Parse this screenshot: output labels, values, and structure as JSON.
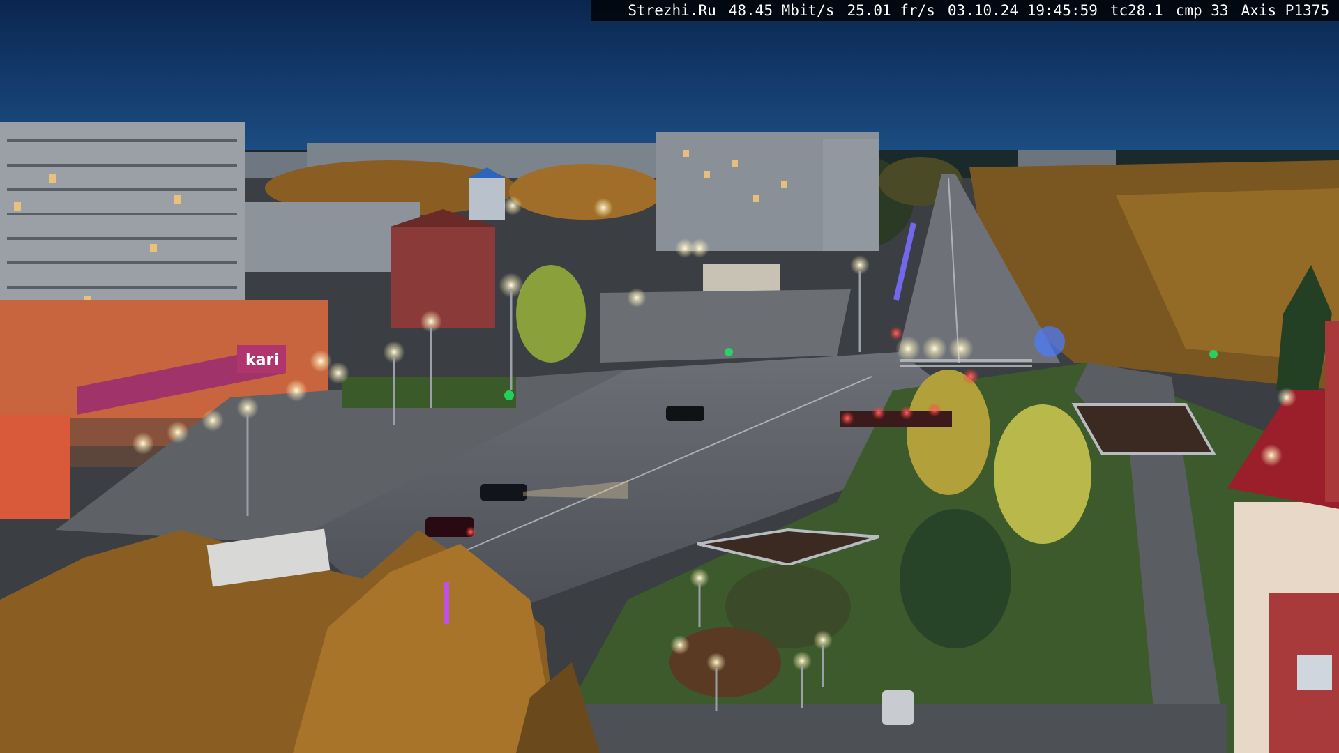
{
  "overlay": {
    "site": "Strezhi.Ru",
    "bitrate": "48.45 Mbit/s",
    "fps": "25.01 fr/s",
    "datetime": "03.10.24 19:45:59",
    "temperature": "tc28.1",
    "compression": "cmp 33",
    "camera": "Axis P1375"
  },
  "scene": {
    "store_sign": "kari",
    "colors": {
      "sky_top": "#0b2650",
      "sky_bottom": "#1c4f86",
      "road": "#55595f",
      "grass": "#2f5a24",
      "autumn_foliage": "#a8742a",
      "streetlight": "#f4f2d8"
    }
  }
}
